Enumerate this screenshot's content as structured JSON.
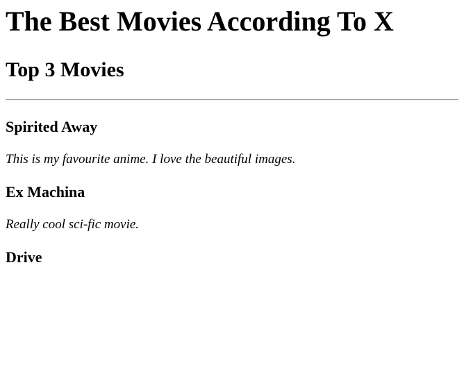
{
  "page": {
    "title": "The Best Movies According To X",
    "subtitle": "Top 3 Movies"
  },
  "movies": [
    {
      "title": "Spirited Away",
      "comment": "This is my favourite anime. I love the beautiful images."
    },
    {
      "title": "Ex Machina",
      "comment": "Really cool sci-fic movie."
    },
    {
      "title": "Drive"
    }
  ]
}
